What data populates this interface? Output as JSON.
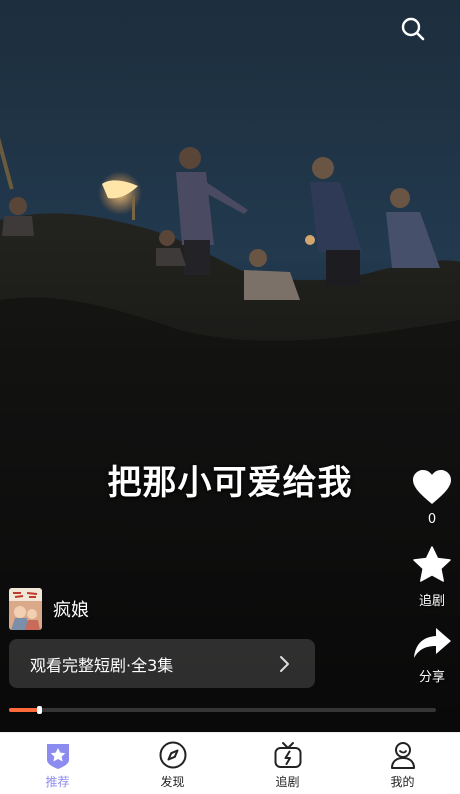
{
  "video": {
    "subtitle": "把那小可爱给我"
  },
  "search": {
    "icon": "search-icon"
  },
  "side_actions": {
    "like": {
      "icon": "heart-icon",
      "count": "0"
    },
    "follow": {
      "icon": "star-icon",
      "label": "追剧"
    },
    "share": {
      "icon": "share-arrow-icon",
      "label": "分享"
    }
  },
  "drama": {
    "title": "疯娘",
    "watch_full_label": "观看完整短剧·全3集"
  },
  "playback": {
    "progress": 0.07
  },
  "tabbar": {
    "active_color": "#8c8cf0",
    "tabs": [
      {
        "label": "推荐",
        "icon": "recommend-star-badge-icon",
        "active": true
      },
      {
        "label": "发现",
        "icon": "compass-icon",
        "active": false
      },
      {
        "label": "追剧",
        "icon": "tv-icon",
        "active": false
      },
      {
        "label": "我的",
        "icon": "profile-icon",
        "active": false
      }
    ]
  },
  "colors": {
    "progress": "#ff6a3d",
    "tab_active": "#8c8cf0"
  }
}
